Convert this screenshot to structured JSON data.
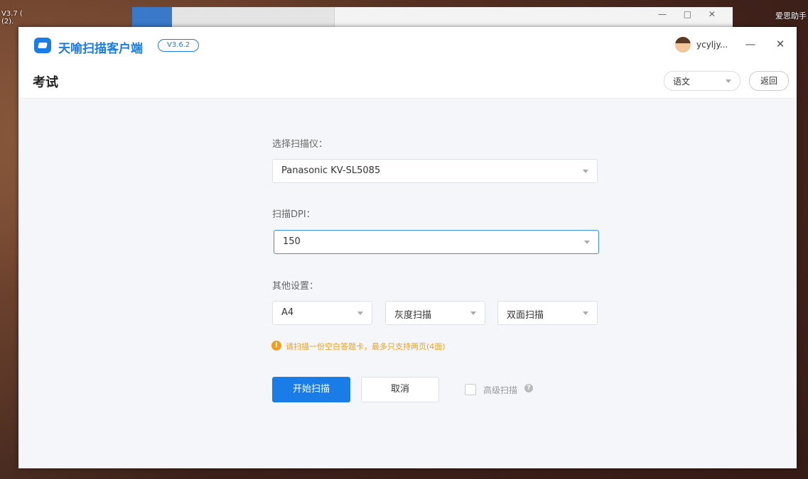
{
  "desktop": {
    "left_label": "V3.7 (\n(2).",
    "right_label": "爱思助手"
  },
  "bg_window": {
    "controls": "— □ ✕"
  },
  "titlebar": {
    "app_name": "天喻扫描客户端",
    "version": "V3.6.2",
    "username": "ycyljy...",
    "minimize_icon": "—",
    "close_icon": "✕"
  },
  "header": {
    "title": "考试",
    "subject": "语文",
    "back_label": "返回"
  },
  "form": {
    "scanner_label": "选择扫描仪：",
    "scanner_value": "Panasonic KV-SL5085",
    "dpi_label": "扫描DPI：",
    "dpi_value": "150",
    "other_label": "其他设置：",
    "paper_size": "A4",
    "color_mode": "灰度扫描",
    "duplex_mode": "双面扫描",
    "hint_icon": "!",
    "hint": "请扫描一份空白答题卡，最多只支持两页(4面)"
  },
  "actions": {
    "start_label": "开始扫描",
    "cancel_label": "取消",
    "advanced_label": "高级扫描",
    "advanced_checked": false,
    "help_icon": "?"
  },
  "colors": {
    "accent": "#1a7ce6",
    "warning": "#f0a020",
    "content_bg": "#f4f6f9"
  }
}
